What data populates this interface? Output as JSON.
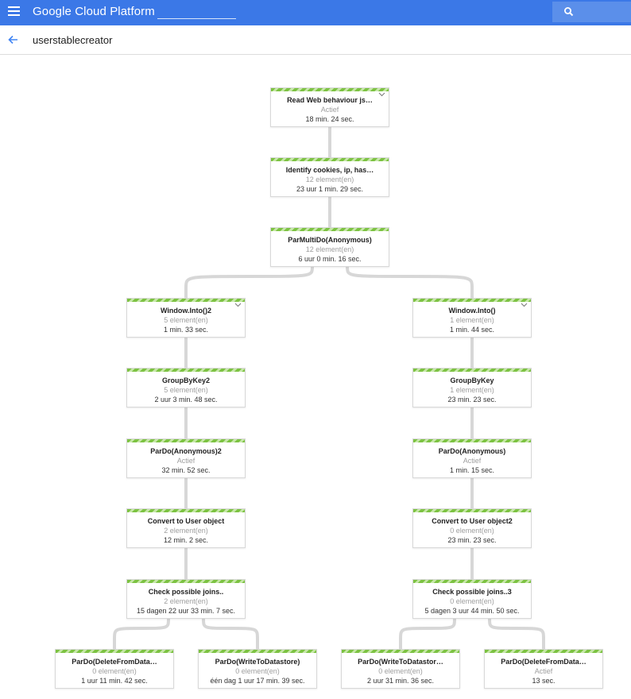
{
  "topbar": {
    "brand": "Google Cloud Platform",
    "project_value": "",
    "search_placeholder": ""
  },
  "header": {
    "job_name": "userstablecreator"
  },
  "colors": {
    "topbar": "#3b78e7",
    "stripe": "#7cc242",
    "edge": "#d7d7d7"
  },
  "icons": {
    "menu": "menu-icon",
    "search": "search-icon",
    "back": "arrow-back-icon",
    "expand": "chevron-down-icon"
  },
  "graph": {
    "nodes": [
      {
        "id": "read",
        "name": "Read Web behaviour js…",
        "status": "Actief",
        "time": "18 min. 24 sec.",
        "expandable": true
      },
      {
        "id": "identify",
        "name": "Identify cookies, ip, has…",
        "status": "12 element(en)",
        "time": "23 uur 1 min. 29 sec.",
        "expandable": false
      },
      {
        "id": "parmulti",
        "name": "ParMultiDo(Anonymous)",
        "status": "12 element(en)",
        "time": "6 uur 0 min. 16 sec.",
        "expandable": false
      },
      {
        "id": "win2",
        "name": "Window.Into()2",
        "status": "5 element(en)",
        "time": "1 min. 33 sec.",
        "expandable": true
      },
      {
        "id": "win1",
        "name": "Window.Into()",
        "status": "1 element(en)",
        "time": "1 min. 44 sec.",
        "expandable": true
      },
      {
        "id": "gbk2",
        "name": "GroupByKey2",
        "status": "5 element(en)",
        "time": "2 uur 3 min. 48 sec.",
        "expandable": false
      },
      {
        "id": "gbk1",
        "name": "GroupByKey",
        "status": "1 element(en)",
        "time": "23 min. 23 sec.",
        "expandable": false
      },
      {
        "id": "pardo2",
        "name": "ParDo(Anonymous)2",
        "status": "Actief",
        "time": "32 min. 52 sec.",
        "expandable": false
      },
      {
        "id": "pardo1",
        "name": "ParDo(Anonymous)",
        "status": "Actief",
        "time": "1 min. 15 sec.",
        "expandable": false
      },
      {
        "id": "conv1",
        "name": "Convert to User object",
        "status": "2 element(en)",
        "time": "12 min. 2 sec.",
        "expandable": false
      },
      {
        "id": "conv2",
        "name": "Convert to User object2",
        "status": "0 element(en)",
        "time": "23 min. 23 sec.",
        "expandable": false
      },
      {
        "id": "check1",
        "name": "Check possible joins..",
        "status": "2 element(en)",
        "time": "15 dagen 22 uur 33 min. 7 sec.",
        "expandable": false
      },
      {
        "id": "check3",
        "name": "Check possible joins..3",
        "status": "0 element(en)",
        "time": "5 dagen 3 uur 44 min. 50 sec.",
        "expandable": false
      },
      {
        "id": "del1",
        "name": "ParDo(DeleteFromData…",
        "status": "0 element(en)",
        "time": "1 uur 11 min. 42 sec.",
        "expandable": false
      },
      {
        "id": "write1",
        "name": "ParDo(WriteToDatastore)",
        "status": "0 element(en)",
        "time": "één dag 1 uur 17 min. 39 sec.",
        "expandable": false
      },
      {
        "id": "write2",
        "name": "ParDo(WriteToDatastor…",
        "status": "0 element(en)",
        "time": "2 uur 31 min. 36 sec.",
        "expandable": false
      },
      {
        "id": "del2",
        "name": "ParDo(DeleteFromData…",
        "status": "Actief",
        "time": "13 sec.",
        "expandable": false
      }
    ],
    "edges": [
      [
        "read",
        "identify"
      ],
      [
        "identify",
        "parmulti"
      ],
      [
        "parmulti",
        "win2"
      ],
      [
        "parmulti",
        "win1"
      ],
      [
        "win2",
        "gbk2"
      ],
      [
        "win1",
        "gbk1"
      ],
      [
        "gbk2",
        "pardo2"
      ],
      [
        "gbk1",
        "pardo1"
      ],
      [
        "pardo2",
        "conv1"
      ],
      [
        "pardo1",
        "conv2"
      ],
      [
        "conv1",
        "check1"
      ],
      [
        "conv2",
        "check3"
      ],
      [
        "check1",
        "del1"
      ],
      [
        "check1",
        "write1"
      ],
      [
        "check3",
        "write2"
      ],
      [
        "check3",
        "del2"
      ]
    ]
  }
}
